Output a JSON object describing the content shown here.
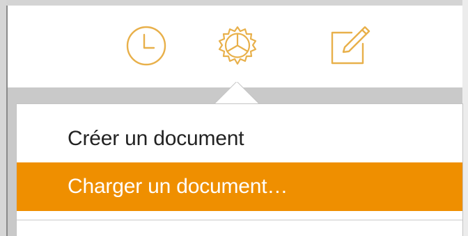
{
  "colors": {
    "accent": "#ef8f00",
    "icon": "#e8b04a"
  },
  "toolbar": {
    "icons": [
      "clock-icon",
      "gear-icon",
      "compose-icon"
    ]
  },
  "menu": {
    "create_label": "Créer un document",
    "upload_label": "Charger un document…"
  }
}
